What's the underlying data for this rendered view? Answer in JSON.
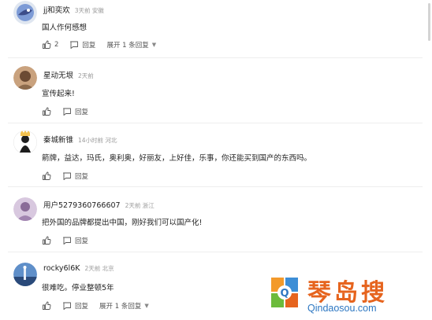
{
  "comments": [
    {
      "username": "jj和奕欢",
      "meta": "3天前 安徽",
      "text": "国人作何感想",
      "like_count": "2",
      "reply_label": "回复",
      "expand_label": "展开 1 条回复"
    },
    {
      "username": "星动无垠",
      "meta": "2天前",
      "text": "宣传起来!",
      "reply_label": "回复"
    },
    {
      "username": "秦城新锥",
      "meta": "14小时前 河北",
      "text": "箭牌，益达，玛氏，奥利奥，好丽友，上好佳，乐事，你还能买到国产的东西吗。",
      "reply_label": "回复"
    },
    {
      "username": "用户5279360766607",
      "meta": "2天前 浙江",
      "text": "把外国的品牌都提出中国，刚好我们可以国产化!",
      "reply_label": "回复"
    },
    {
      "username": "rocky6l6K",
      "meta": "2天前 北京",
      "text": "很难吃。停业整顿5年",
      "reply_label": "回复",
      "expand_label": "展开 1 条回复"
    }
  ],
  "watermark": {
    "title": "琴岛搜",
    "url": "Qindaosou.com"
  },
  "icons": {
    "like": "thumbs-up-icon",
    "reply": "reply-icon",
    "expand": "chevron-down-icon"
  },
  "colors": {
    "meta_gray": "#9a9a9a",
    "watermark_orange": "#e6641e",
    "watermark_blue": "#2d77c2"
  }
}
